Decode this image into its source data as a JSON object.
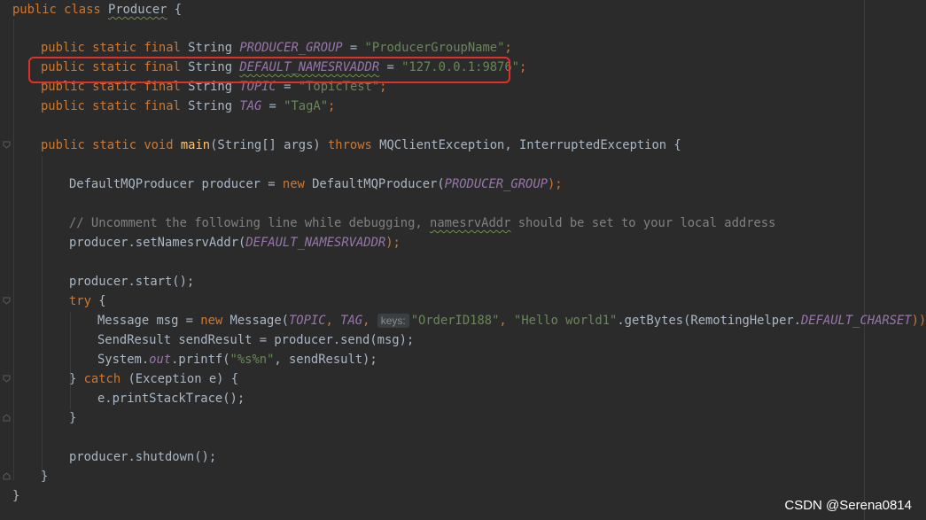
{
  "editor": {
    "lines": {
      "l1": [
        "public",
        " ",
        "class",
        " ",
        "Producer",
        " {"
      ],
      "l2": [
        "public",
        " ",
        "static",
        " ",
        "final",
        " ",
        "String",
        " ",
        "PRODUCER_GROUP",
        " = ",
        "\"ProducerGroupName\"",
        ";"
      ],
      "l3": [
        "public",
        " ",
        "static",
        " ",
        "final",
        " ",
        "String",
        " ",
        "DEFAULT_NAMESRVADDR",
        " = ",
        "\"127.0.0.1:9876\"",
        ";"
      ],
      "l4": [
        "public",
        " ",
        "static",
        " ",
        "final",
        " ",
        "String",
        " ",
        "TOPIC",
        " = ",
        "\"TopicTest\"",
        ";"
      ],
      "l5": [
        "public",
        " ",
        "static",
        " ",
        "final",
        " ",
        "String",
        " ",
        "TAG",
        " = ",
        "\"TagA\"",
        ";"
      ],
      "l6": [
        "public",
        " ",
        "static",
        " ",
        "void",
        " ",
        "main",
        "(String[] args) ",
        "throws",
        " MQClientException, InterruptedException {"
      ],
      "l7": [
        "DefaultMQProducer producer = ",
        "new",
        " DefaultMQProducer(",
        "PRODUCER_GROUP",
        ");"
      ],
      "l8": [
        "// Uncomment the following line while debugging, ",
        "namesrvAddr",
        " should be set to your local address"
      ],
      "l9": [
        "producer.setNamesrvAddr(",
        "DEFAULT_NAMESRVADDR",
        ");"
      ],
      "l10": [
        "producer.start();"
      ],
      "l11": [
        "try",
        " {"
      ],
      "l12": [
        "Message msg = ",
        "new",
        " Message(",
        "TOPIC",
        ", ",
        "TAG",
        ", ",
        "keys:",
        "\"OrderID188\"",
        ", ",
        "\"Hello world1\"",
        ".getBytes(RemotingHelper.",
        "DEFAULT_CHARSET",
        "));"
      ],
      "l13": [
        "SendResult sendResult = producer.send(msg);"
      ],
      "l14": [
        "System.",
        "out",
        ".printf(",
        "\"%s%n\"",
        ", sendResult);"
      ],
      "l15": [
        "} ",
        "catch",
        " (Exception e) {"
      ],
      "l16": [
        "e.printStackTrace();"
      ],
      "l17": [
        "}"
      ],
      "l18": [
        "producer.shutdown();"
      ],
      "l19": [
        "}"
      ],
      "l20": [
        "}"
      ]
    }
  },
  "watermark": "CSDN @Serena0814",
  "colors": {
    "background": "#2b2b2b",
    "keyword": "#cc7832",
    "string": "#6a8759",
    "constant": "#9876aa",
    "function": "#ffc66d",
    "comment": "#808080",
    "highlight_box": "#e0302a"
  },
  "icons": [
    "fold-marker-icon"
  ]
}
